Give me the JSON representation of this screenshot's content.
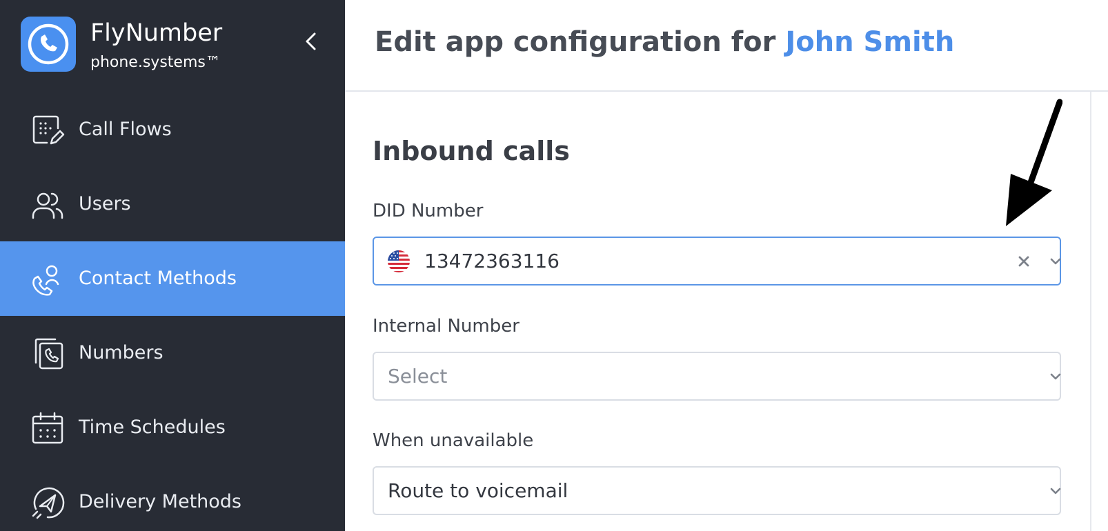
{
  "brand": {
    "name": "FlyNumber",
    "subtitle": "phone.systems™"
  },
  "sidebar": {
    "items": [
      {
        "label": "Call Flows",
        "icon": "call-flows-icon"
      },
      {
        "label": "Users",
        "icon": "users-icon"
      },
      {
        "label": "Contact Methods",
        "icon": "contact-methods-icon",
        "active": true
      },
      {
        "label": "Numbers",
        "icon": "numbers-icon"
      },
      {
        "label": "Time Schedules",
        "icon": "calendar-icon"
      },
      {
        "label": "Delivery Methods",
        "icon": "delivery-icon"
      }
    ]
  },
  "header": {
    "title_prefix": "Edit app configuration for",
    "user_name": "John Smith"
  },
  "form": {
    "section_title": "Inbound calls",
    "did": {
      "label": "DID Number",
      "value": "13472363116",
      "flag": "us-flag-icon"
    },
    "internal": {
      "label": "Internal Number",
      "placeholder": "Select"
    },
    "unavailable": {
      "label": "When unavailable",
      "value": "Route to voicemail"
    }
  },
  "colors": {
    "sidebar_bg": "#282c35",
    "active_bg": "#5595ed",
    "accent": "#4d8ee8",
    "focus_border": "#5b96e6"
  }
}
